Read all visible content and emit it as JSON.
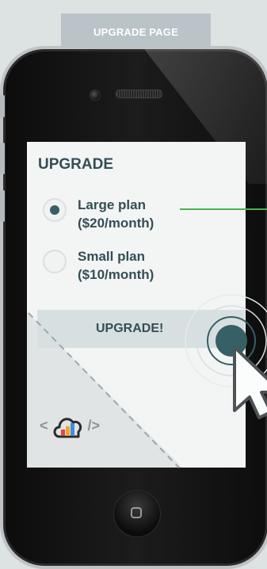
{
  "page_tag": "UPGRADE PAGE",
  "screen": {
    "title": "UPGRADE",
    "options": [
      {
        "label_line1": "Large plan",
        "label_line2": "($20/month)",
        "selected": true
      },
      {
        "label_line1": "Small plan",
        "label_line2": "($10/month)",
        "selected": false
      }
    ],
    "upgrade_button": "UPGRADE!",
    "logo_left_glyph": "<",
    "logo_right_glyph": "/>"
  },
  "colors": {
    "accent": "#375f66",
    "connector": "#4db050",
    "button_bg": "#d8dfe0",
    "text": "#344e55"
  },
  "icons": [
    "phone-camera-icon",
    "phone-speaker-icon",
    "home-button-icon",
    "cursor-icon",
    "touch-target-icon",
    "cloud-chart-logo-icon"
  ]
}
